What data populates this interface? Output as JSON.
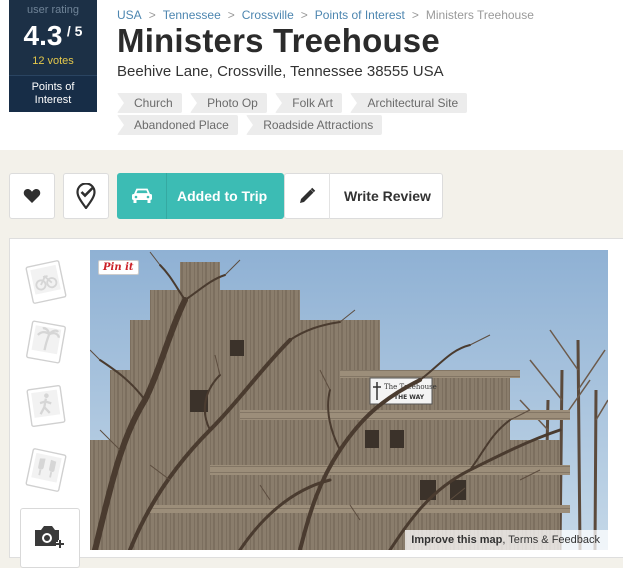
{
  "rating": {
    "label": "user rating",
    "score": "4.3",
    "out_of": "/ 5",
    "votes": "12 votes",
    "category_line1": "Points of",
    "category_line2": "Interest"
  },
  "breadcrumb": [
    "USA",
    "Tennessee",
    "Crossville",
    "Points of Interest",
    "Ministers Treehouse"
  ],
  "title": "Ministers Treehouse",
  "address": "Beehive Lane, Crossville, Tennessee 38555 USA",
  "tags": [
    "Church",
    "Photo Op",
    "Folk Art",
    "Architectural Site",
    "Abandoned Place",
    "Roadside Attractions"
  ],
  "actions": {
    "heart_icon": "heart-icon",
    "check_icon": "map-check-icon",
    "trip_label": "Added to Trip",
    "trip_icon": "car-icon",
    "review_label": "Write Review",
    "review_icon": "pencil-icon"
  },
  "photo": {
    "pin_label": "Pin it",
    "sign_line1": "The Treehouse",
    "sign_line2": "THE WAY",
    "improve_map": "Improve this map",
    "terms": "Terms & Feedback"
  },
  "colors": {
    "navy": "#1c3046",
    "teal": "#3cbcb4",
    "gold": "#e4c84b",
    "link": "#4d86b0"
  }
}
